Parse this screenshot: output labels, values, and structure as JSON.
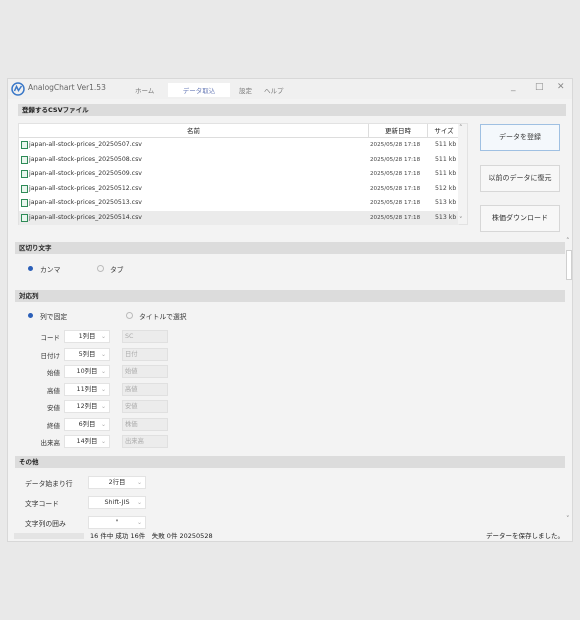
{
  "app": {
    "title": "AnalogChart Ver1.53"
  },
  "menu": {
    "tabs": [
      {
        "label": "ホーム"
      },
      {
        "label": "データ取込"
      },
      {
        "label": "設定"
      },
      {
        "label": "ヘルプ"
      }
    ],
    "active_tab": "データ取込"
  },
  "window_controls": {
    "minimize": "_",
    "maximize": "□",
    "close": "✕"
  },
  "csv_section": {
    "title": "登録するCSVファイル",
    "columns": {
      "name": "名前",
      "date": "更新日時",
      "size": "サイズ"
    },
    "files": [
      {
        "name": "japan-all-stock-prices_20250507.csv",
        "date": "2025/05/28 17:18",
        "size": "511 kb"
      },
      {
        "name": "japan-all-stock-prices_20250508.csv",
        "date": "2025/05/28 17:18",
        "size": "511 kb"
      },
      {
        "name": "japan-all-stock-prices_20250509.csv",
        "date": "2025/05/28 17:18",
        "size": "511 kb"
      },
      {
        "name": "japan-all-stock-prices_20250512.csv",
        "date": "2025/05/28 17:18",
        "size": "512 kb"
      },
      {
        "name": "japan-all-stock-prices_20250513.csv",
        "date": "2025/05/28 17:18",
        "size": "513 kb"
      },
      {
        "name": "japan-all-stock-prices_20250514.csv",
        "date": "2025/05/28 17:18",
        "size": "513 kb"
      }
    ]
  },
  "side_buttons": {
    "register": "データを登録",
    "restore": "以前のデータに復元",
    "download": "株価ダウンロード"
  },
  "delimiter": {
    "title": "区切り文字",
    "options": [
      "カンマ",
      "タブ"
    ],
    "selected": "カンマ"
  },
  "column_map": {
    "title": "対応列",
    "modes": [
      "列で固定",
      "タイトルで選択"
    ],
    "selected_mode": "列で固定",
    "fields": [
      {
        "label": "コード",
        "column": "1列目",
        "title": "SC"
      },
      {
        "label": "日付け",
        "column": "5列目",
        "title": "日付"
      },
      {
        "label": "始値",
        "column": "10列目",
        "title": "始値"
      },
      {
        "label": "高値",
        "column": "11列目",
        "title": "高値"
      },
      {
        "label": "安値",
        "column": "12列目",
        "title": "安値"
      },
      {
        "label": "終値",
        "column": "6列目",
        "title": "株価"
      },
      {
        "label": "出来高",
        "column": "14列目",
        "title": "出来高"
      }
    ]
  },
  "other": {
    "title": "その他",
    "start_row_label": "データ始まり行",
    "start_row_value": "2行目",
    "encoding_label": "文字コード",
    "encoding_value": "Shift-JIS",
    "quote_label": "文字列の囲み",
    "quote_value": "\""
  },
  "status": {
    "summary": "16 件中 成功 16件　失敗 0件 20250528",
    "message": "データーを保存しました。"
  },
  "colors": {
    "accent": "#2b5fb8",
    "file_icon": "#2e8b57"
  }
}
